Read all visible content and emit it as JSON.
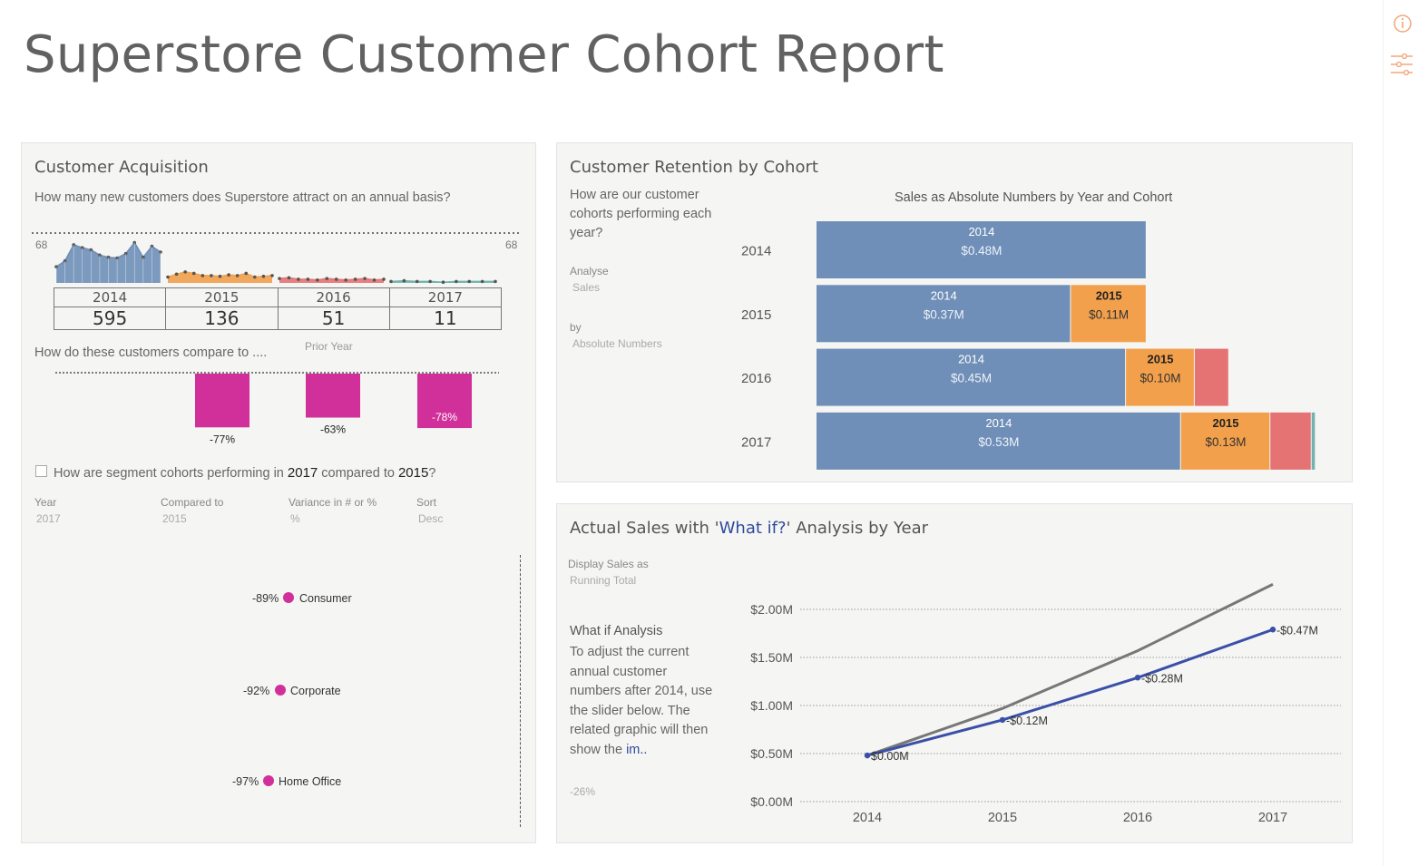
{
  "page": {
    "title": "Superstore Customer Cohort Report",
    "icons": [
      "info-icon",
      "filter-sliders-icon"
    ]
  },
  "acquisition": {
    "title": "Customer Acquisition",
    "question": "How many new customers does Superstore attract on an annual basis?",
    "ref_left": "68",
    "ref_right": "68",
    "years": [
      "2014",
      "2015",
      "2016",
      "2017"
    ],
    "counts": [
      "595",
      "136",
      "51",
      "11"
    ],
    "compare_question": "How do these customers compare to ....",
    "compare_mode": "Prior Year",
    "variance_labels": [
      "-77%",
      "-63%",
      "-78%"
    ],
    "variance_values": [
      -77,
      -63,
      -78
    ],
    "segment_question_pre": "How are segment cohorts performing in ",
    "segment_year": "2017",
    "segment_question_mid": " compared to ",
    "segment_compare_year": "2015",
    "segment_question_post": "?",
    "filters": {
      "year_label": "Year",
      "year_value": "2017",
      "compared_label": "Compared to",
      "compared_value": "2015",
      "variance_label": "Variance in # or %",
      "variance_value": "%",
      "sort_label": "Sort",
      "sort_value": "Desc"
    },
    "segments": [
      {
        "name": "Consumer",
        "pct": "-89%"
      },
      {
        "name": "Corporate",
        "pct": "-92%"
      },
      {
        "name": "Home Office",
        "pct": "-97%"
      }
    ],
    "colors": {
      "2014": "#6f8fb8",
      "2015": "#f2a04b",
      "2016": "#e57373",
      "2017": "#6fb3aa",
      "variance": "#d1309a"
    }
  },
  "retention": {
    "title": "Customer Retention by Cohort",
    "question": "How are our customer cohorts performing each year?",
    "analyse_label": "Analyse",
    "analyse_value": "Sales",
    "by_label": "by",
    "by_value": "Absolute Numbers",
    "chart_title": "Sales as Absolute Numbers by Year and Cohort"
  },
  "whatif": {
    "title_pre": "Actual Sales with '",
    "title_highlight": "What if?",
    "title_post": "' Analysis by Year",
    "display_label": "Display Sales as",
    "display_value": "Running Total",
    "analysis_title": "What if Analysis",
    "analysis_text": "To adjust the current annual customer numbers after 2014, use the slider below. The related graphic will then show the",
    "analysis_link": "im..",
    "slider_value": "-26%"
  },
  "chart_data": [
    {
      "type": "area",
      "title": "",
      "series": [
        {
          "name": "2014",
          "values": [
            22,
            30,
            52,
            48,
            45,
            38,
            35,
            34,
            40,
            55,
            35,
            50,
            42
          ]
        },
        {
          "name": "2015",
          "values": [
            8,
            12,
            15,
            13,
            10,
            10,
            9,
            11,
            10,
            13,
            8,
            9,
            10
          ]
        },
        {
          "name": "2016",
          "values": [
            6,
            7,
            5,
            5,
            4,
            6,
            5,
            4,
            5,
            6,
            4,
            5
          ]
        },
        {
          "name": "2017",
          "values": [
            2,
            3,
            2,
            2,
            1,
            2,
            2,
            2,
            2
          ]
        }
      ],
      "reference_line": 68
    },
    {
      "type": "bar",
      "title": "Sales as Absolute Numbers by Year and Cohort",
      "categories": [
        "2014",
        "2015",
        "2016",
        "2017"
      ],
      "series": [
        {
          "name": "2014",
          "values": [
            0.48,
            0.37,
            0.45,
            0.53
          ],
          "labels": [
            "$0.48M",
            "$0.37M",
            "$0.45M",
            "$0.53M"
          ]
        },
        {
          "name": "2015",
          "values": [
            0,
            0.11,
            0.1,
            0.13
          ],
          "labels": [
            "",
            "$0.11M",
            "$0.10M",
            "$0.13M"
          ]
        },
        {
          "name": "2016",
          "values": [
            0,
            0,
            0.05,
            0.06
          ],
          "labels": [
            "",
            "",
            "",
            ""
          ]
        },
        {
          "name": "2017",
          "values": [
            0,
            0,
            0,
            0.006
          ],
          "labels": [
            "",
            "",
            "",
            ""
          ]
        }
      ],
      "stacked": true,
      "orientation": "horizontal"
    },
    {
      "type": "line",
      "title": "",
      "x": [
        "2014",
        "2015",
        "2016",
        "2017"
      ],
      "yticks": [
        "$0.00M",
        "$0.50M",
        "$1.00M",
        "$1.50M",
        "$2.00M"
      ],
      "ylim": [
        0,
        2.2
      ],
      "series": [
        {
          "name": "",
          "values": [
            0.48,
            0.97,
            1.57,
            2.26
          ]
        },
        {
          "name": "",
          "values": [
            0.48,
            0.85,
            1.29,
            1.79
          ],
          "labels": [
            "$0.00M",
            "-$0.12M",
            "-$0.28M",
            "-$0.47M"
          ]
        }
      ],
      "grid": true
    }
  ]
}
